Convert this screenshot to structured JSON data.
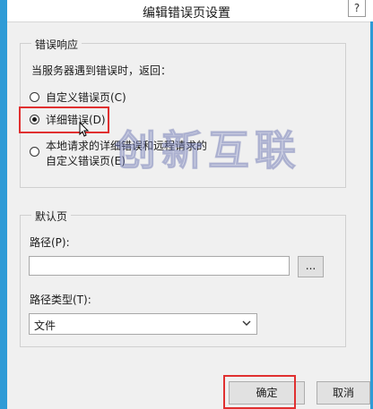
{
  "window": {
    "title": "编辑错误页设置",
    "help_icon": "?"
  },
  "error_response": {
    "legend": "错误响应",
    "prompt": "当服务器遇到错误时，返回：",
    "options": [
      {
        "label": "自定义错误页(C)",
        "checked": false
      },
      {
        "label": "详细错误(D)",
        "checked": true
      },
      {
        "label_line1": "本地请求的详细错误和远程请求的",
        "label_line2": "自定义错误页(E)",
        "checked": false
      }
    ]
  },
  "default_page": {
    "legend": "默认页",
    "path_label": "路径(P):",
    "path_value": "",
    "browse_label": "...",
    "path_type_label": "路径类型(T):",
    "path_type_value": "文件"
  },
  "buttons": {
    "ok": "确定",
    "cancel": "取消"
  },
  "watermark": "创新互联",
  "colors": {
    "accent": "#2f9bd6",
    "highlight": "#e03030"
  }
}
